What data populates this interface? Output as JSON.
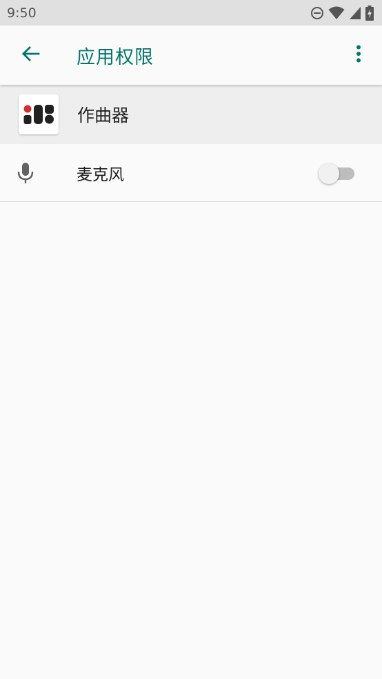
{
  "status_bar": {
    "time": "9:50",
    "icons": [
      "do-not-disturb-icon",
      "wifi-icon",
      "signal-icon",
      "battery-charging-icon"
    ]
  },
  "app_bar": {
    "title": "应用权限",
    "back_icon": "arrow-back-icon",
    "overflow_icon": "more-vert-icon"
  },
  "app_header": {
    "app_name": "作曲器"
  },
  "permissions": [
    {
      "label": "麦克风",
      "icon": "microphone-icon",
      "enabled": false
    }
  ],
  "colors": {
    "accent": "#00796b",
    "background": "#fafafa",
    "status_bar": "#e0e0e0",
    "header_row": "#eeeeee"
  }
}
